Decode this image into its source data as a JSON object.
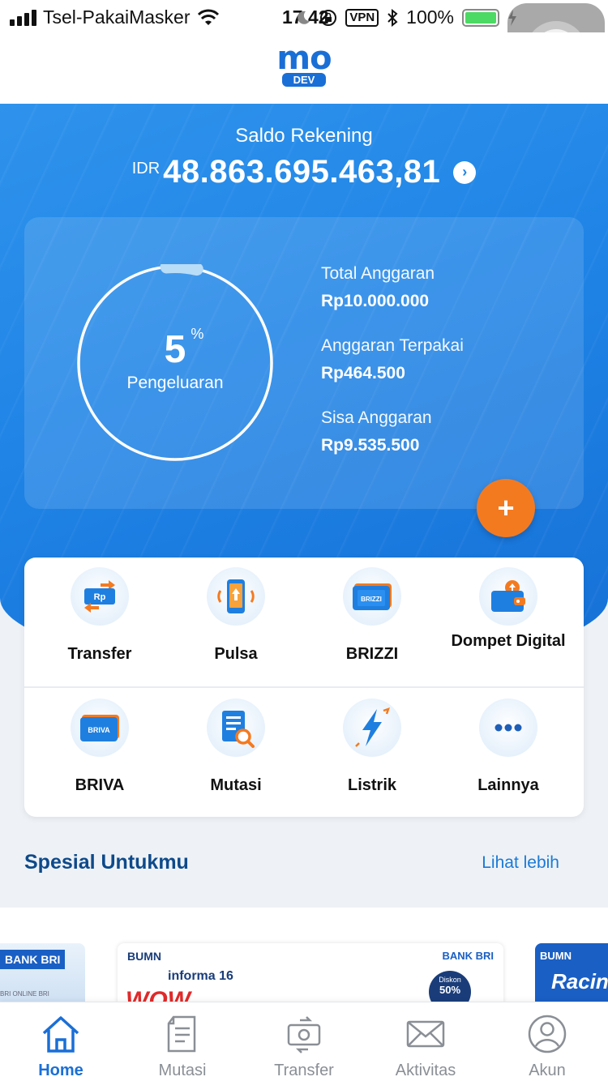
{
  "status_bar": {
    "carrier": "Tsel-PakaiMasker",
    "time": "17.42",
    "vpn": "VPN",
    "battery": "100%",
    "battery_level": 1.0
  },
  "header": {
    "logo": "mo",
    "env_badge": "DEV"
  },
  "balance": {
    "label": "Saldo Rekening",
    "currency": "IDR",
    "amount": "48.863.695.463,81"
  },
  "budget": {
    "percent": "5",
    "percent_symbol": "%",
    "percent_value": 0.05,
    "ring_label": "Pengeluaran",
    "stats": [
      {
        "label": "Total Anggaran",
        "value": "Rp10.000.000"
      },
      {
        "label": "Anggaran Terpakai",
        "value": "Rp464.500"
      },
      {
        "label": "Sisa Anggaran",
        "value": "Rp9.535.500"
      }
    ],
    "add_label": "+"
  },
  "menu": {
    "items": [
      {
        "label": "Transfer",
        "icon": "transfer-icon"
      },
      {
        "label": "Pulsa",
        "icon": "phone-icon"
      },
      {
        "label": "BRIZZI",
        "icon": "brizzi-card-icon"
      },
      {
        "label": "Dompet Digital",
        "icon": "wallet-icon"
      },
      {
        "label": "BRIVA",
        "icon": "briva-card-icon"
      },
      {
        "label": "Mutasi",
        "icon": "document-search-icon"
      },
      {
        "label": "Listrik",
        "icon": "lightning-icon"
      },
      {
        "label": "Lainnya",
        "icon": "more-icon"
      }
    ],
    "brizzi_card_text": "BRIZZI",
    "briva_card_text": "BRIVA",
    "transfer_card_text": "Rp"
  },
  "promo": {
    "title": "Spesial Untukmu",
    "more": "Lihat lebih",
    "banners": [
      {
        "brand": "BANK BRI",
        "sub": "BRI ONLINE BRI"
      },
      {
        "bumn": "BUMN",
        "brand": "BANK BRI",
        "event": "informa 16",
        "headline": "WOW",
        "discount_label": "Diskon",
        "discount_value": "50%"
      },
      {
        "bumn": "BUMN",
        "headline": "Racin"
      }
    ]
  },
  "tabbar": {
    "tabs": [
      {
        "label": "Home",
        "icon": "home-icon",
        "active": true
      },
      {
        "label": "Mutasi",
        "icon": "mutasi-icon",
        "active": false
      },
      {
        "label": "Transfer",
        "icon": "transfer-tab-icon",
        "active": false
      },
      {
        "label": "Aktivitas",
        "icon": "envelope-icon",
        "active": false
      },
      {
        "label": "Akun",
        "icon": "account-icon",
        "active": false
      }
    ]
  },
  "colors": {
    "primary": "#1a6fd6",
    "accent_orange": "#f47a20",
    "title_navy": "#0e4a8a",
    "tab_inactive": "#8a8f96"
  }
}
